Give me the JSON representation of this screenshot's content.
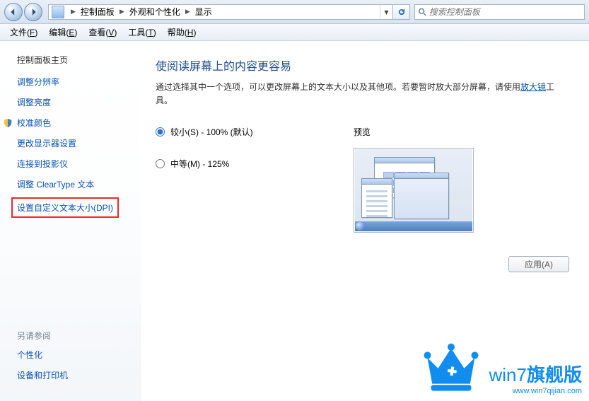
{
  "addressbar": {
    "crumbs": [
      "控制面板",
      "外观和个性化",
      "显示"
    ],
    "search_placeholder": "搜索控制面板"
  },
  "menubar": [
    {
      "label": "文件",
      "accel": "F"
    },
    {
      "label": "编辑",
      "accel": "E"
    },
    {
      "label": "查看",
      "accel": "V"
    },
    {
      "label": "工具",
      "accel": "T"
    },
    {
      "label": "帮助",
      "accel": "H"
    }
  ],
  "sidebar": {
    "header": "控制面板主页",
    "links": [
      {
        "label": "调整分辨率",
        "shield": false
      },
      {
        "label": "调整亮度",
        "shield": false
      },
      {
        "label": "校准颜色",
        "shield": true
      },
      {
        "label": "更改显示器设置",
        "shield": false
      },
      {
        "label": "连接到投影仪",
        "shield": false
      },
      {
        "label": "调整 ClearType 文本",
        "shield": false
      },
      {
        "label": "设置自定义文本大小(DPI)",
        "shield": false,
        "highlighted": true
      }
    ],
    "see_also": {
      "header": "另请参阅",
      "items": [
        "个性化",
        "设备和打印机"
      ]
    }
  },
  "content": {
    "title": "使阅读屏幕上的内容更容易",
    "desc_pre": "通过选择其中一个选项，可以更改屏幕上的文本大小以及其他项。若要暂时放大部分屏幕，请使用",
    "desc_link": "放大镜",
    "desc_post": "工具。",
    "options": [
      {
        "value": "small",
        "label": "较小(S) - 100% (默认)",
        "checked": true
      },
      {
        "value": "medium",
        "label": "中等(M) - 125%",
        "checked": false
      }
    ],
    "preview_label": "预览",
    "apply_label": "应用(A)"
  },
  "watermark": {
    "brand_pre": "win7",
    "brand_bold": "旗舰版",
    "url": "www.win7qijian.com"
  }
}
